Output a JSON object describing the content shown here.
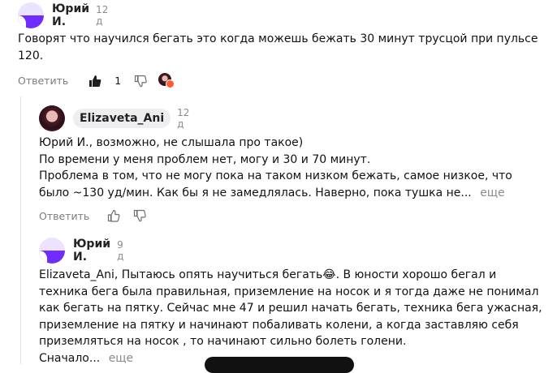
{
  "comments": [
    {
      "author": "Юрий И.",
      "date": "12 д",
      "lines": [
        "Говорят что научился бегать это когда можешь бежать 30 минут трусцой при пульсе",
        "120."
      ],
      "reply_label": "Ответить",
      "likes": "1"
    },
    {
      "author": "Elizaveta_Ani",
      "date": "12 д",
      "lines": [
        "Юрий И., возможно, не слышала про такое)",
        "По времени у меня проблем нет, могу и 30 и 70 минут.",
        "Проблема в том, что не могу пока на таком низком бежать, самое низкое, что",
        "было ~130 уд/мин. Как бы я не замедлялась. Наверно, пока тушка не..."
      ],
      "more_label": "еще",
      "reply_label": "Ответить"
    },
    {
      "author": "Юрий И.",
      "date": "9 д",
      "lines": [
        "Elizaveta_Ani, Пытаюсь опять научиться бегать😂. В юности хорошо бегал и",
        "техника бега была правильная, приземление на носок и я тогда даже не понимал",
        "как бегать на пятку. Сейчас мне 47 и решил начать бегать, техника бега ужасная,",
        "приземление на пятку и начинают побаливать колени, а когда заставляю себя",
        "приземляться на носок , то начинают сильно болеть голени.",
        "Сначало..."
      ],
      "more_label": "еще"
    }
  ]
}
